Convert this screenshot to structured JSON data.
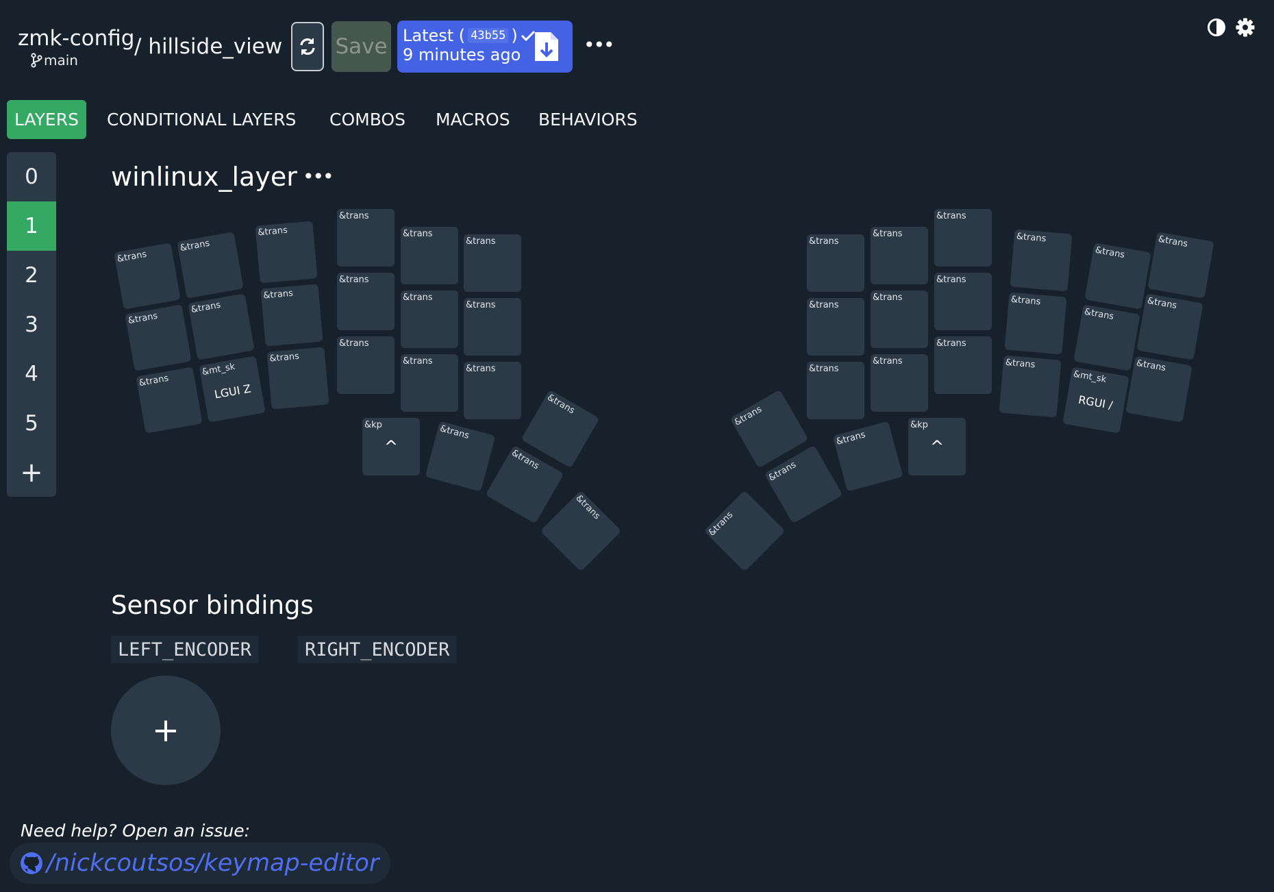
{
  "header": {
    "repo": "zmk-config",
    "branch": "main",
    "keyboard": "/ hillside_view",
    "save_label": "Save",
    "latest_label": "Latest (",
    "latest_hash": "43b55",
    "latest_close": ")",
    "latest_time": "9 minutes ago",
    "more": "•••"
  },
  "tabs": [
    "LAYERS",
    "CONDITIONAL LAYERS",
    "COMBOS",
    "MACROS",
    "BEHAVIORS"
  ],
  "layers": {
    "items": [
      "0",
      "1",
      "2",
      "3",
      "4",
      "5"
    ],
    "add": "+",
    "active_index": 1
  },
  "layer": {
    "name": "winlinux_layer",
    "more": "•••"
  },
  "keys": {
    "trans": "&trans",
    "kp": "&kp",
    "mt_sk": "&mt_sk",
    "caret": "^",
    "lgui_z": "LGUI Z",
    "rgui_slash": "RGUI /"
  },
  "sensors": {
    "title": "Sensor bindings",
    "left": "LEFT_ENCODER",
    "right": "RIGHT_ENCODER",
    "add": "+"
  },
  "footer": {
    "help": "Need help? Open an issue:",
    "link": "/nickcoutsos/keymap-editor"
  },
  "colors": {
    "background": "#17212b",
    "key": "#2c3a47",
    "accent_green": "#35a964",
    "accent_blue": "#4463e4",
    "link": "#4f6ff0"
  }
}
